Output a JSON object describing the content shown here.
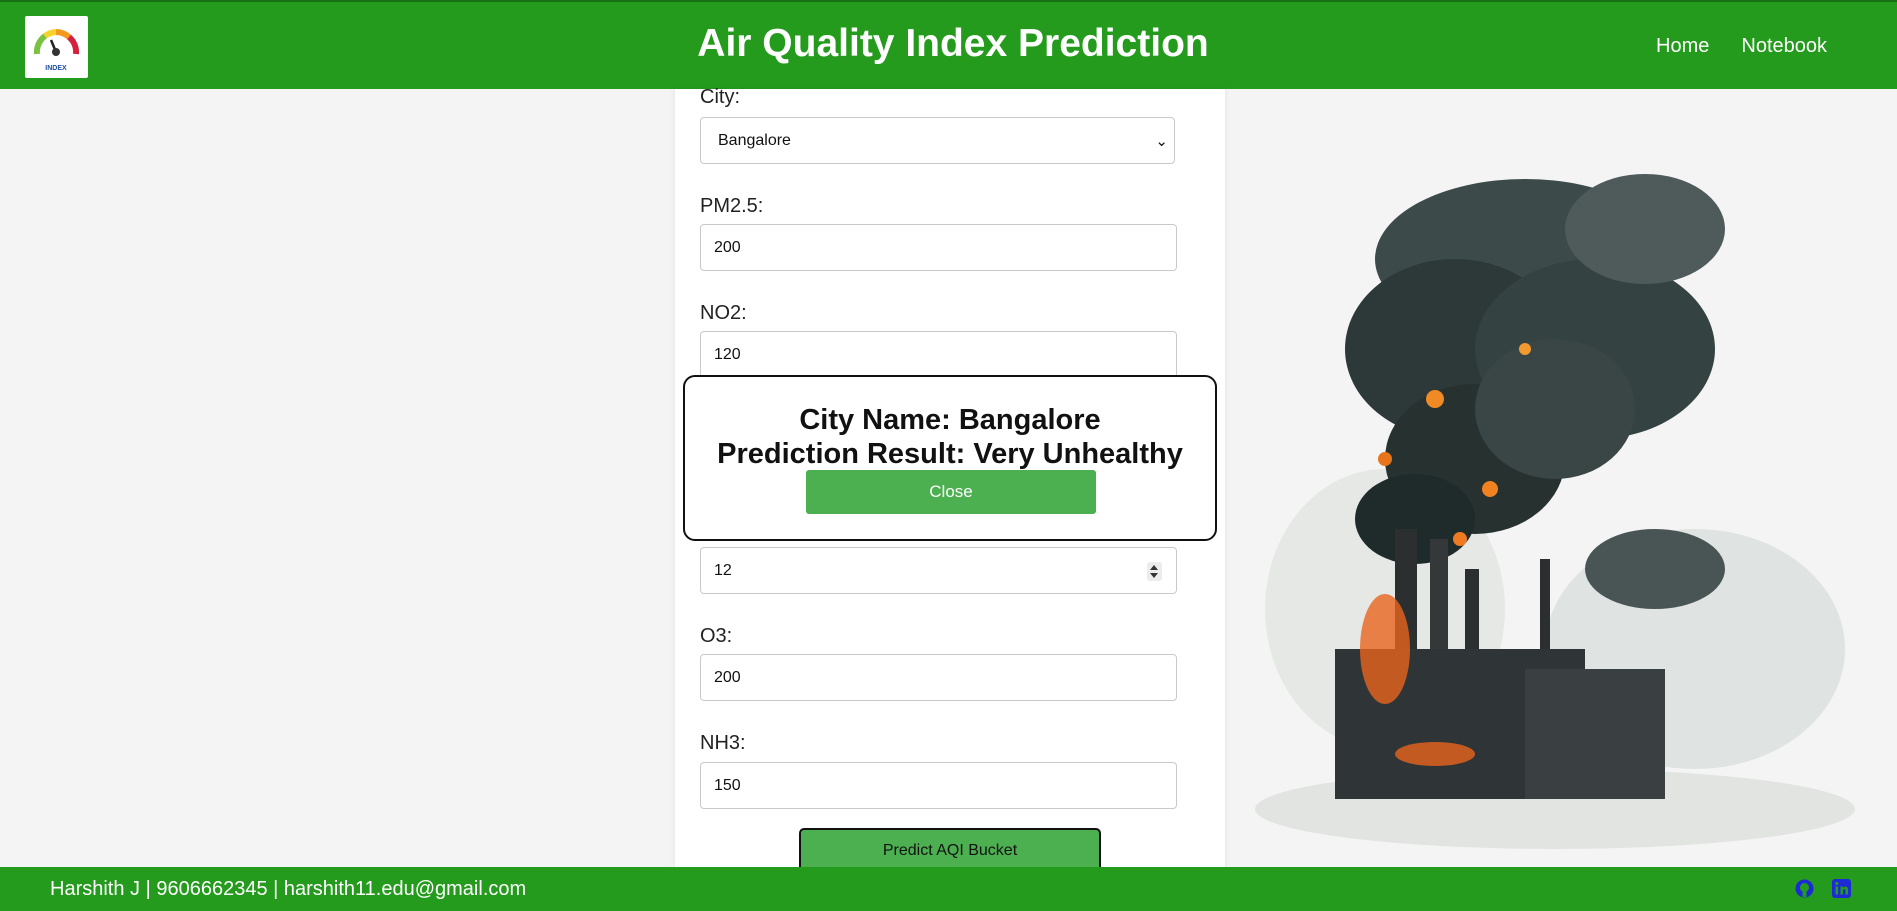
{
  "header": {
    "title": "Air Quality Index Prediction",
    "logo_text": "INDEX",
    "nav": [
      "Home",
      "Notebook"
    ]
  },
  "form": {
    "city_label": "City:",
    "city_value": "Bangalore",
    "pm25_label": "PM2.5:",
    "pm25_value": "200",
    "no2_label": "NO2:",
    "no2_value": "120",
    "co_value": "12",
    "o3_label": "O3:",
    "o3_value": "200",
    "nh3_label": "NH3:",
    "nh3_value": "150",
    "submit_label": "Predict AQI Bucket"
  },
  "modal": {
    "city_line": "City Name: Bangalore",
    "result_line": "Prediction Result: Very Unhealthy",
    "close_label": "Close"
  },
  "footer": {
    "text": "Harshith J | 9606662345 | harshith11.edu@gmail.com"
  },
  "icons": {
    "social": [
      "github-icon",
      "linkedin-icon"
    ],
    "form": [
      "chevron-down-icon",
      "spinner-icon"
    ]
  },
  "colors": {
    "brand_green": "#249b1d",
    "button_green": "#4caf50",
    "link_blue": "#1d2bd4"
  }
}
